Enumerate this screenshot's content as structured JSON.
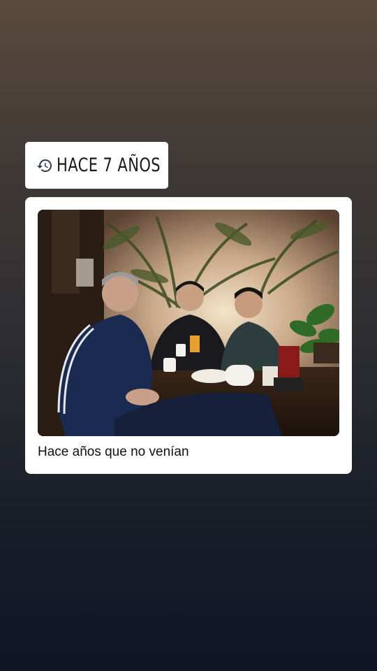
{
  "memory": {
    "label": "HACE 7 AÑOS",
    "icon": "history-icon"
  },
  "post": {
    "caption": "Hace años que no venían",
    "photo": "photo"
  }
}
